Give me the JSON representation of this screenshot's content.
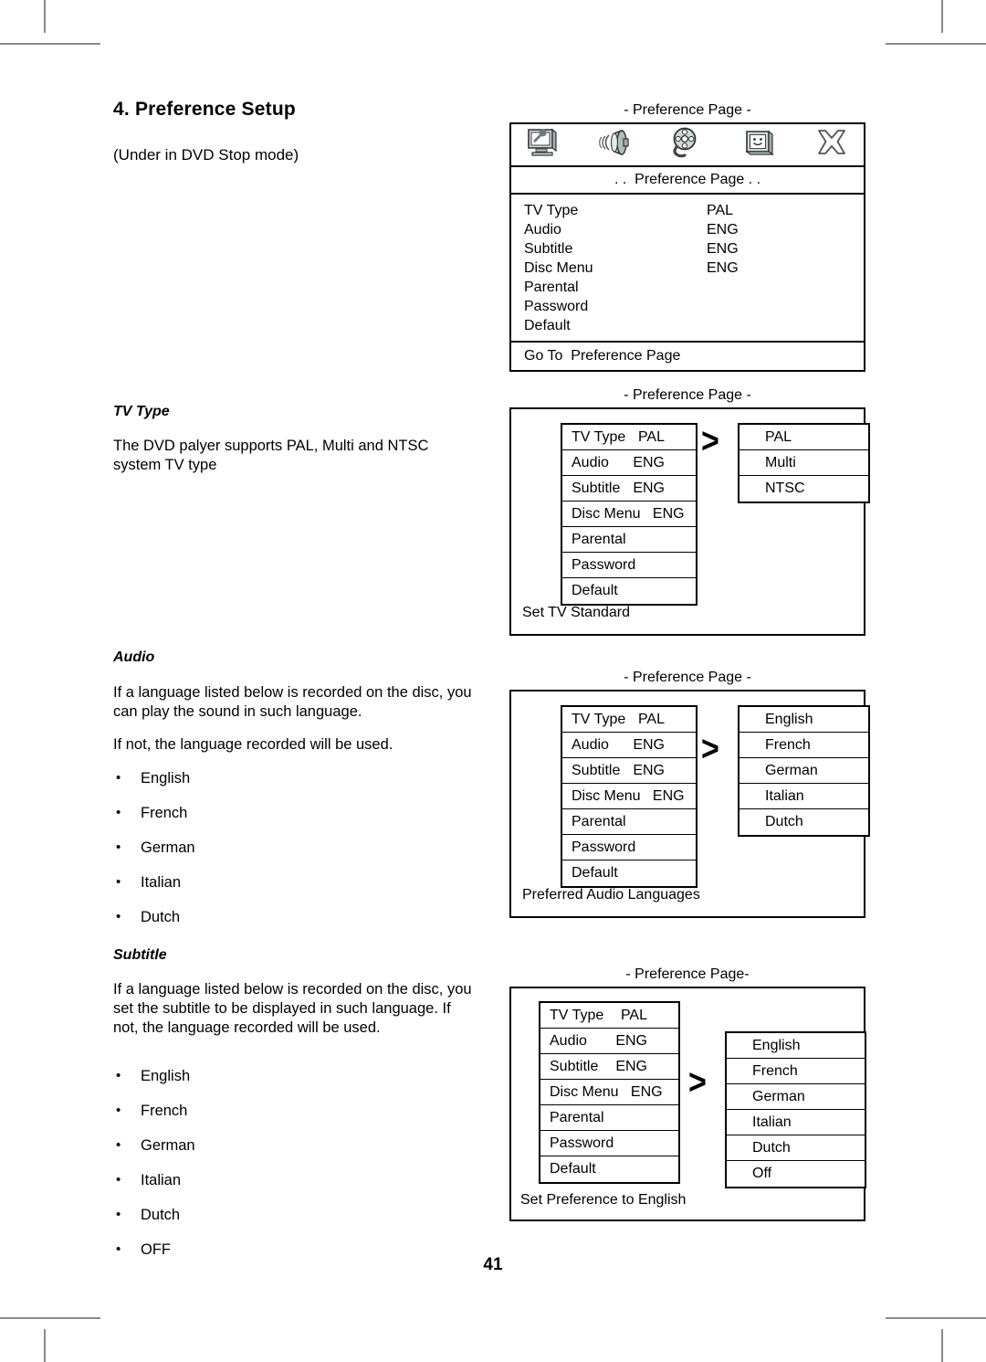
{
  "page": {
    "number": "41",
    "heading": "4. Preference Setup",
    "subnote": "(Under in DVD Stop mode)"
  },
  "sections": {
    "tv_type": {
      "heading": "TV Type",
      "body": "The DVD palyer supports PAL, Multi and NTSC system TV type"
    },
    "audio": {
      "heading": "Audio",
      "body1": "If a language listed below is recorded on the disc, you can play the sound in such language.",
      "body2": "If not, the language recorded will be used.",
      "options": [
        "English",
        "French",
        "German",
        "Italian",
        "Dutch"
      ]
    },
    "subtitle": {
      "heading": "Subtitle",
      "body": "If a language listed below is recorded on the disc, you set the subtitle to be displayed in such language. If not, the language recorded will be used.",
      "options": [
        "English",
        "French",
        "German",
        "Italian",
        "Dutch",
        "OFF"
      ]
    }
  },
  "osd_main": {
    "caption": "- Preference Page -",
    "icons": [
      "general-setup-icon",
      "audio-setup-icon",
      "video-setup-icon",
      "preference-setup-icon",
      "exit-setup-icon"
    ],
    "title": ". .  Preference Page . .",
    "rows": [
      {
        "label": "TV Type",
        "value": "PAL"
      },
      {
        "label": "Audio",
        "value": "ENG"
      },
      {
        "label": "Subtitle",
        "value": "ENG"
      },
      {
        "label": "Disc Menu",
        "value": "ENG"
      },
      {
        "label": "Parental",
        "value": ""
      },
      {
        "label": "Password",
        "value": ""
      },
      {
        "label": "Default",
        "value": ""
      }
    ],
    "footer": "Go To  Preference Page"
  },
  "osd_tvtype": {
    "caption": "- Preference Page -",
    "menu": [
      {
        "label": "TV Type",
        "value": "PAL"
      },
      {
        "label": "Audio",
        "value": "ENG"
      },
      {
        "label": "Subtitle",
        "value": "ENG"
      },
      {
        "label": "Disc Menu   ENG",
        "value": ""
      },
      {
        "label": "Parental",
        "value": ""
      },
      {
        "label": "Password",
        "value": ""
      },
      {
        "label": "Default",
        "value": ""
      }
    ],
    "arrow": ">",
    "submenu": [
      "PAL",
      "Multi",
      "NTSC"
    ],
    "footer": "Set TV Standard"
  },
  "osd_audio": {
    "caption": "- Preference Page -",
    "menu": [
      {
        "label": "TV Type",
        "value": "PAL"
      },
      {
        "label": "Audio",
        "value": "ENG"
      },
      {
        "label": "Subtitle",
        "value": "ENG"
      },
      {
        "label": "Disc Menu   ENG",
        "value": ""
      },
      {
        "label": "Parental",
        "value": ""
      },
      {
        "label": "Password",
        "value": ""
      },
      {
        "label": "Default",
        "value": ""
      }
    ],
    "arrow": ">",
    "submenu": [
      "English",
      "French",
      "German",
      "Italian",
      "Dutch"
    ],
    "footer": "Preferred Audio Languages"
  },
  "osd_subtitle": {
    "caption": "- Preference Page-",
    "menu": [
      {
        "label": "TV Type",
        "value": "PAL"
      },
      {
        "label": "Audio",
        "value": "ENG"
      },
      {
        "label": "Subtitle",
        "value": "ENG"
      },
      {
        "label": "Disc Menu   ENG",
        "value": ""
      },
      {
        "label": "Parental",
        "value": ""
      },
      {
        "label": "Password",
        "value": ""
      },
      {
        "label": "Default",
        "value": ""
      }
    ],
    "arrow": ">",
    "submenu": [
      "English",
      "French",
      "German",
      "Italian",
      "Dutch",
      "Off"
    ],
    "footer": "Set Preference to English"
  },
  "colors": {
    "ink": "#000000",
    "paper": "#ffffff",
    "crop_mark": "#8a8a8a",
    "icon_fill": "#c9d6d6"
  }
}
